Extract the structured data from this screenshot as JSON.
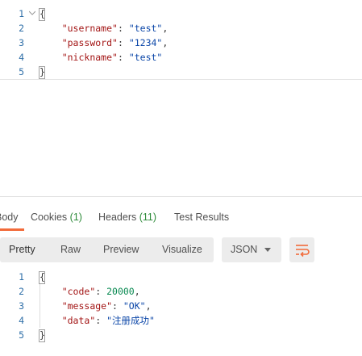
{
  "request_body": {
    "lines": [
      {
        "n": "1",
        "parts": [
          {
            "t": "{",
            "c": "punct"
          }
        ]
      },
      {
        "n": "2",
        "parts": [
          {
            "t": "    ",
            "c": "punct"
          },
          {
            "t": "\"username\"",
            "c": "key"
          },
          {
            "t": ": ",
            "c": "punct"
          },
          {
            "t": "\"test\"",
            "c": "str"
          },
          {
            "t": ",",
            "c": "punct"
          }
        ]
      },
      {
        "n": "3",
        "parts": [
          {
            "t": "    ",
            "c": "punct"
          },
          {
            "t": "\"password\"",
            "c": "key"
          },
          {
            "t": ": ",
            "c": "punct"
          },
          {
            "t": "\"1234\"",
            "c": "str"
          },
          {
            "t": ",",
            "c": "punct"
          }
        ]
      },
      {
        "n": "4",
        "parts": [
          {
            "t": "    ",
            "c": "punct"
          },
          {
            "t": "\"nickname\"",
            "c": "key"
          },
          {
            "t": ": ",
            "c": "punct"
          },
          {
            "t": "\"test\"",
            "c": "str"
          }
        ]
      },
      {
        "n": "5",
        "parts": [
          {
            "t": "}",
            "c": "punct"
          }
        ]
      }
    ]
  },
  "response_tabs": {
    "body": "Body",
    "cookies": "Cookies",
    "cookies_count": "(1)",
    "headers": "Headers",
    "headers_count": "(11)",
    "test_results": "Test Results"
  },
  "response_toolbar": {
    "pretty": "Pretty",
    "raw": "Raw",
    "preview": "Preview",
    "visualize": "Visualize",
    "format": "JSON"
  },
  "response_body": {
    "lines": [
      {
        "n": "1",
        "parts": [
          {
            "t": "{",
            "c": "punct"
          }
        ]
      },
      {
        "n": "2",
        "parts": [
          {
            "t": "    ",
            "c": "punct"
          },
          {
            "t": "\"code\"",
            "c": "key"
          },
          {
            "t": ": ",
            "c": "punct"
          },
          {
            "t": "20000",
            "c": "num"
          },
          {
            "t": ",",
            "c": "punct"
          }
        ]
      },
      {
        "n": "3",
        "parts": [
          {
            "t": "    ",
            "c": "punct"
          },
          {
            "t": "\"message\"",
            "c": "key"
          },
          {
            "t": ": ",
            "c": "punct"
          },
          {
            "t": "\"OK\"",
            "c": "str"
          },
          {
            "t": ",",
            "c": "punct"
          }
        ]
      },
      {
        "n": "4",
        "parts": [
          {
            "t": "    ",
            "c": "punct"
          },
          {
            "t": "\"data\"",
            "c": "key"
          },
          {
            "t": ": ",
            "c": "punct"
          },
          {
            "t": "\"注册成功\"",
            "c": "str"
          }
        ]
      },
      {
        "n": "5",
        "parts": [
          {
            "t": "}",
            "c": "punct"
          }
        ]
      }
    ]
  },
  "colors": {
    "accent": "#f26b3a",
    "key": "#a31515",
    "string": "#0b46a8",
    "number": "#0a8a52",
    "count": "#2e8b3a",
    "line_number": "#2f6fa8"
  },
  "icons": {
    "fold": "chevron-down-icon",
    "format_caret": "caret-down-icon",
    "wrap": "text-wrap-icon"
  }
}
